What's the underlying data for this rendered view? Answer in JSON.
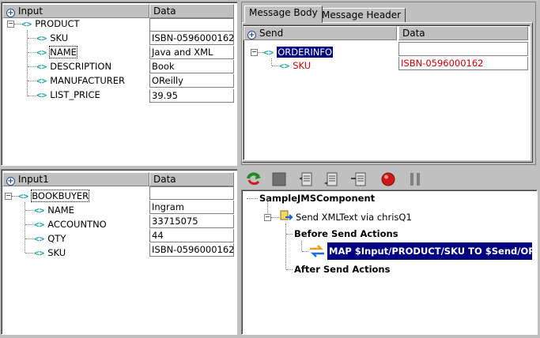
{
  "input_panel": {
    "header_input": "Input",
    "header_data": "Data",
    "tree": [
      {
        "label": "PRODUCT",
        "value": ""
      },
      {
        "label": "SKU",
        "value": "ISBN-0596000162"
      },
      {
        "label": "NAME",
        "value": "Java and XML"
      },
      {
        "label": "DESCRIPTION",
        "value": "Book"
      },
      {
        "label": "MANUFACTURER",
        "value": "OReilly"
      },
      {
        "label": "LIST_PRICE",
        "value": "39.95"
      }
    ]
  },
  "input1_panel": {
    "header_input": "Input1",
    "header_data": "Data",
    "tree": [
      {
        "label": "BOOKBUYER",
        "value": ""
      },
      {
        "label": "NAME",
        "value": "Ingram"
      },
      {
        "label": "ACCOUNTNO",
        "value": "33715075"
      },
      {
        "label": "QTY",
        "value": "44"
      },
      {
        "label": "SKU",
        "value": "ISBN-0596000162"
      }
    ]
  },
  "message_panel": {
    "tabs": [
      "Message Body",
      "Message Header"
    ],
    "header_send": "Send",
    "header_data": "Data",
    "tree": [
      {
        "label": "ORDERINFO",
        "value": ""
      },
      {
        "label": "SKU",
        "value": "ISBN-0596000162"
      }
    ]
  },
  "actions_panel": {
    "toolbar_icons": [
      "refresh-icon",
      "stop-icon",
      "list-icon-1",
      "list-icon-2",
      "list-icon-3",
      "record-icon",
      "pause-icon"
    ],
    "component": "SampleJMSComponent",
    "send_node": "Send XMLText via chrisQ1",
    "before": "Before Send Actions",
    "map_action": "MAP $Input/PRODUCT/SKU TO $Send/ORDERINFO/SKU",
    "after": "After Send Actions"
  },
  "colors": {
    "selection": "#000080",
    "link_red": "#cc0000",
    "tag_teal": "#1aa3a3"
  }
}
